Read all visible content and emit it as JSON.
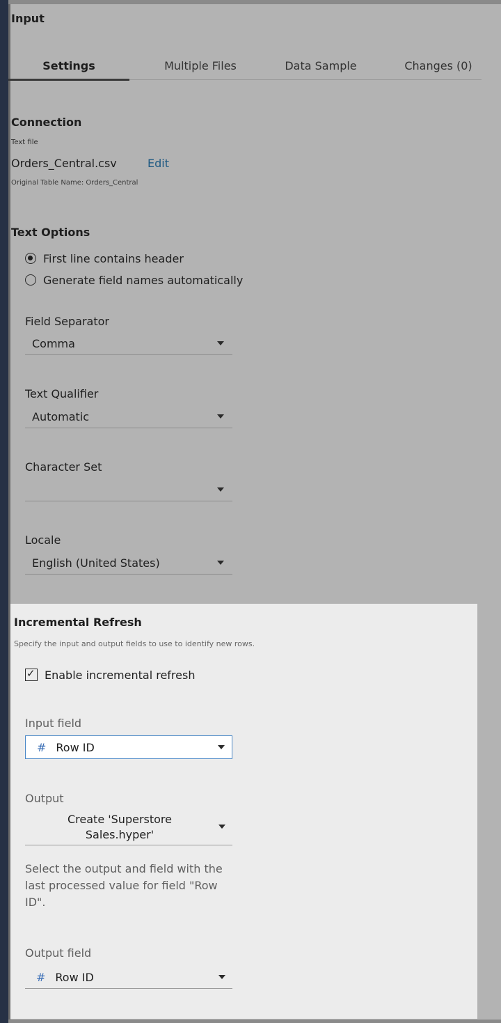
{
  "panel": {
    "title": "Input"
  },
  "tabs": [
    {
      "label": "Settings",
      "active": true
    },
    {
      "label": "Multiple Files",
      "active": false
    },
    {
      "label": "Data Sample",
      "active": false
    },
    {
      "label": "Changes (0)",
      "active": false
    }
  ],
  "connection": {
    "title": "Connection",
    "type": "Text file",
    "file_name": "Orders_Central.csv",
    "edit_label": "Edit",
    "original_table": "Original Table Name: Orders_Central"
  },
  "text_options": {
    "title": "Text Options",
    "option_header": "First line contains header",
    "option_generate": "Generate field names automatically",
    "selected": "First line contains header"
  },
  "field_separator": {
    "label": "Field Separator",
    "value": "Comma"
  },
  "text_qualifier": {
    "label": "Text Qualifier",
    "value": "Automatic"
  },
  "character_set": {
    "label": "Character Set",
    "value": ""
  },
  "locale": {
    "label": "Locale",
    "value": "English (United States)"
  },
  "incremental_refresh": {
    "title": "Incremental Refresh",
    "description": "Specify the input and output fields to use to identify new rows.",
    "enable_label": "Enable incremental refresh",
    "enabled": true,
    "input_field_label": "Input field",
    "input_field_value": "Row ID",
    "output_label": "Output",
    "output_line1": "Create 'Superstore",
    "output_line2": "Sales.hyper'",
    "help_text": "Select the output and field with the last processed value for field \"Row ID\".",
    "output_field_label": "Output field",
    "output_field_value": "Row ID"
  },
  "icons": {
    "field_type": "#"
  }
}
